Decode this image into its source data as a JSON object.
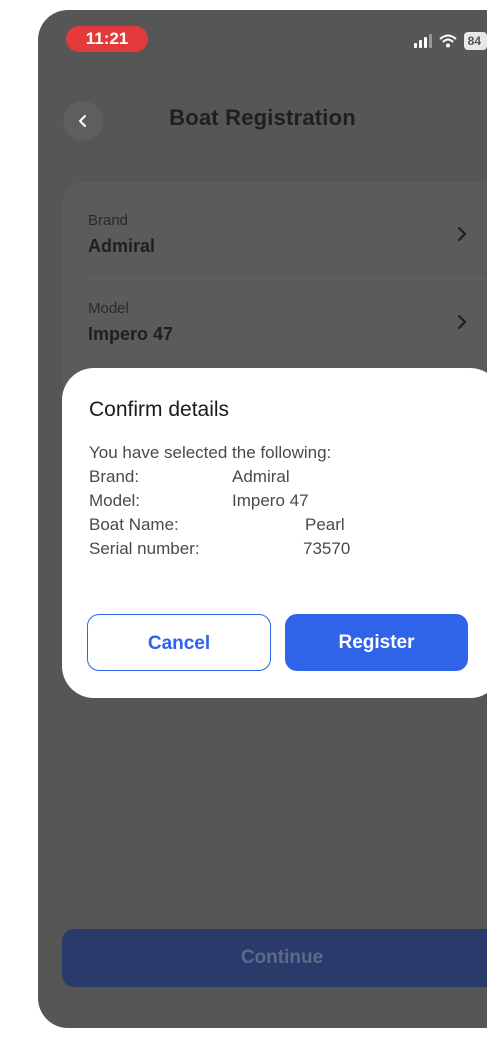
{
  "status_bar": {
    "time": "11:21",
    "battery": "84"
  },
  "header": {
    "title": "Boat Registration"
  },
  "form": {
    "brand_label": "Brand",
    "brand_value": "Admiral",
    "model_label": "Model",
    "model_value": "Impero 47"
  },
  "footer": {
    "continue_label": "Continue"
  },
  "dialog": {
    "title": "Confirm details",
    "intro": "You have selected the following:",
    "rows": [
      {
        "key": "Brand:",
        "value": "Admiral"
      },
      {
        "key": "Model:",
        "value": "Impero 47"
      },
      {
        "key": "Boat Name:",
        "value": "Pearl"
      },
      {
        "key": "Serial number:",
        "value": "73570"
      }
    ],
    "cancel_label": "Cancel",
    "register_label": "Register"
  }
}
